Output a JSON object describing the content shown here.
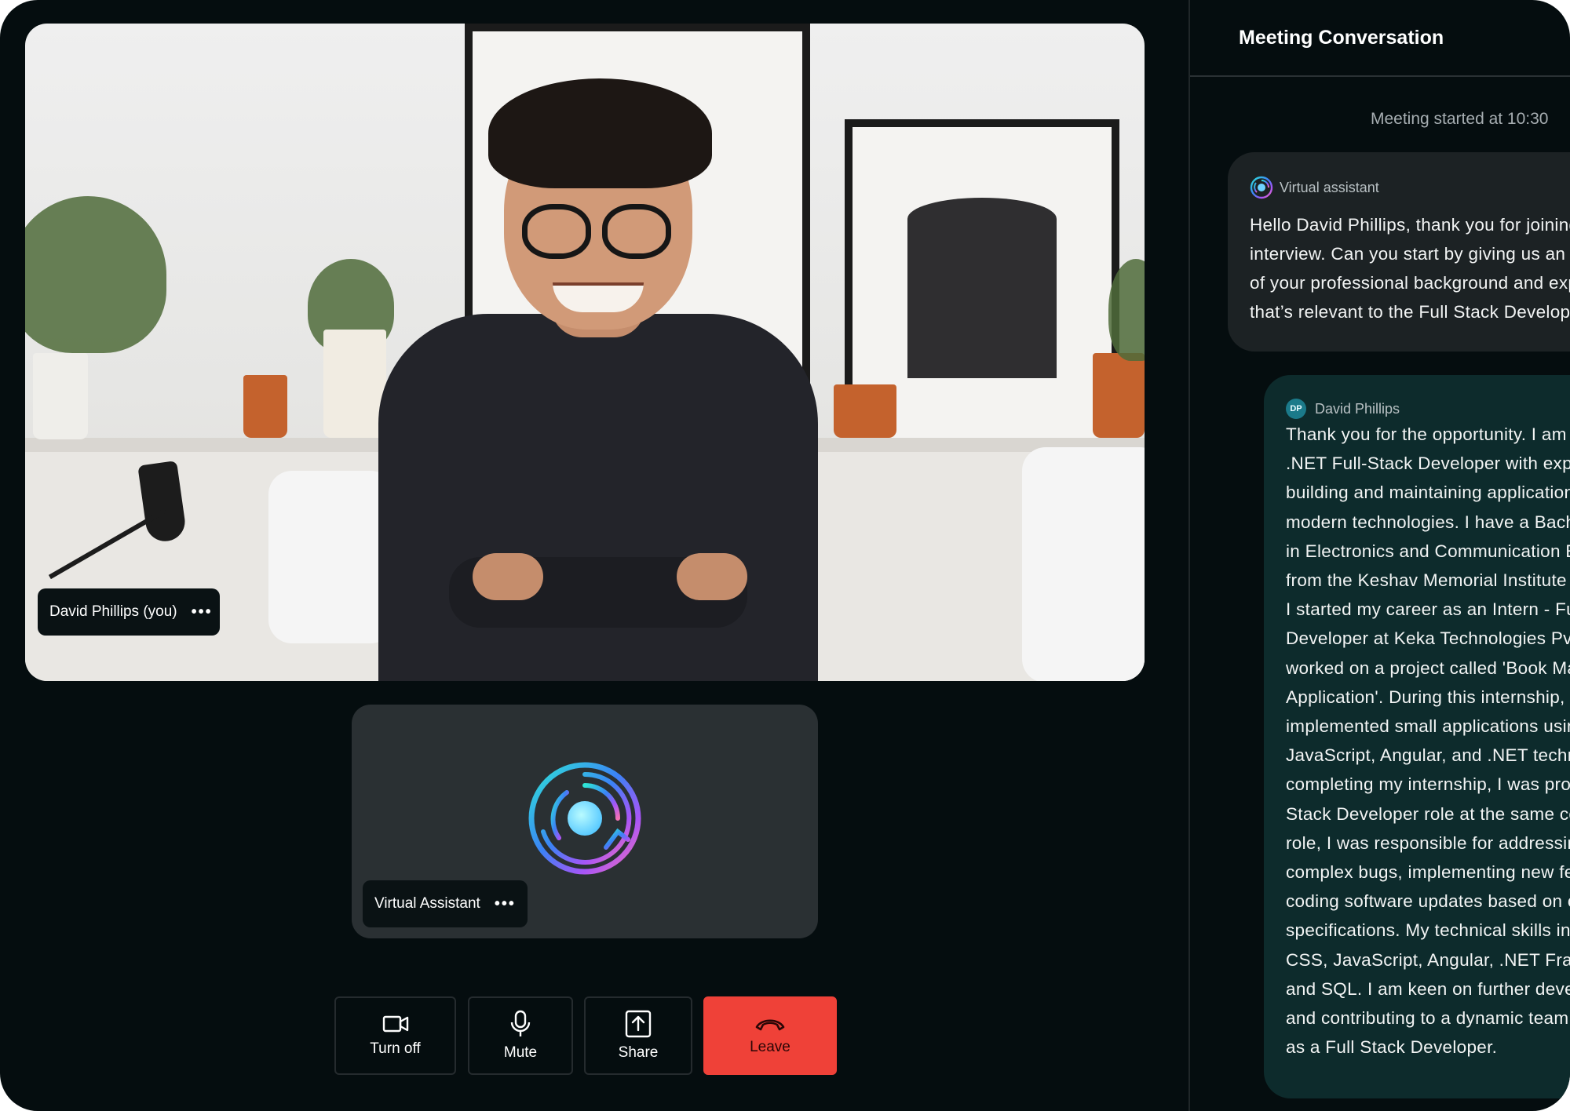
{
  "main_video": {
    "participant_name": "David Phillips (you)",
    "more_label": "•••"
  },
  "assistant_tile": {
    "participant_name": "Virtual Assistant",
    "more_label": "•••"
  },
  "controls": {
    "camera_label": "Turn off",
    "mic_label": "Mute",
    "share_label": "Share",
    "leave_label": "Leave"
  },
  "panel": {
    "title": "Meeting Conversation",
    "meeting_started": "Meeting started at 10:30",
    "messages": [
      {
        "sender": "Virtual assistant",
        "lines": [
          "Hello David Phillips, thank you for joining the",
          "interview. Can you start by giving us an overview",
          "of your professional background and experience",
          "that’s relevant to the Full Stack Developer role?"
        ]
      },
      {
        "sender": "David Phillips",
        "avatar_initials": "DP",
        "lines": [
          "Thank you for the opportunity. I am a",
          ".NET Full-Stack Developer with experience in",
          "building and maintaining applications using",
          "modern technologies. I have a Bachelor's degree",
          "in Electronics and Communication Engineering",
          "from the Keshav Memorial Institute of Technology.",
          "I started my career as an Intern - Full Stack",
          "Developer at Keka Technologies Pvt Ltd, where I",
          "worked on a project called 'Book Management",
          "Application'. During this internship, I",
          "implemented small applications using HTML, CSS,",
          "JavaScript, Angular, and .NET technologies. After",
          "completing my internship, I was promoted to a Full",
          "Stack Developer role at the same company. In this",
          "role, I was responsible for addressing and fixing",
          "complex bugs, implementing new features, and",
          "coding software updates based on client",
          "specifications. My technical skills include HTML,",
          "CSS, JavaScript, Angular, .NET Framework, C#,",
          "and SQL. I am keen on further developing my skills",
          "and contributing to a dynamic team in my next role",
          "as a Full Stack Developer."
        ]
      }
    ]
  },
  "colors": {
    "background": "#050d0f",
    "leave_button": "#ef4138",
    "assistant_bubble": "#1c2224",
    "user_bubble": "#0d2b2c"
  },
  "icons": [
    "video-camera-icon",
    "microphone-icon",
    "share-upload-icon",
    "phone-hangup-icon",
    "assistant-logo-icon"
  ]
}
